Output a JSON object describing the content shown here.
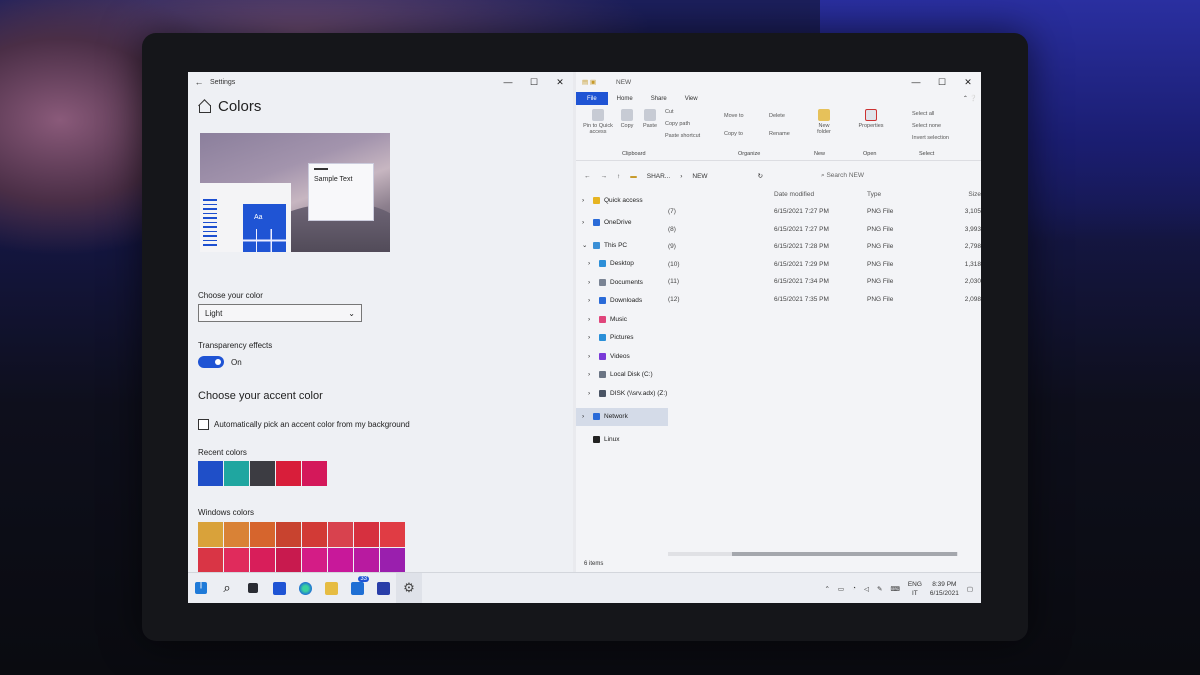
{
  "settings": {
    "window_title": "Settings",
    "heading": "Colors",
    "preview_sample_text": "Sample Text",
    "preview_tile_text": "Aa",
    "choose_color_label": "Choose your color",
    "choose_color_value": "Light",
    "transparency_label": "Transparency effects",
    "transparency_state": "On",
    "accent_heading": "Choose your accent color",
    "auto_accent_label": "Automatically pick an accent color from my background",
    "recent_colors_label": "Recent colors",
    "recent_colors": [
      "#1f4fc8",
      "#1fa6a0",
      "#3c3c42",
      "#d81e3a",
      "#d4185a"
    ],
    "windows_colors_label": "Windows colors",
    "windows_colors_row1": [
      "#d9a23a",
      "#d98236",
      "#d6652d",
      "#c8432f",
      "#d23a36",
      "#d8424e",
      "#d6303f",
      "#e03c44"
    ],
    "windows_colors_row2": [
      "#d93545",
      "#e02b5c",
      "#d81e5a",
      "#c81a4e",
      "#d41c86",
      "#c8189a",
      "#b81aa0",
      "#9a1fae"
    ]
  },
  "explorer": {
    "window_title": "NEW",
    "tabs": [
      "File",
      "Home",
      "Share",
      "View"
    ],
    "ribbon": {
      "pin": "Pin to Quick access",
      "copy": "Copy",
      "paste": "Paste",
      "cut": "Cut",
      "copy_path": "Copy path",
      "paste_shortcut": "Paste shortcut",
      "move_to": "Move to",
      "copy_to": "Copy to",
      "delete": "Delete",
      "rename": "Rename",
      "new_folder": "New folder",
      "properties": "Properties",
      "select_all": "Select all",
      "select_none": "Select none",
      "invert_selection": "Invert selection",
      "groups": [
        "Clipboard",
        "Organize",
        "New",
        "Open",
        "Select"
      ]
    },
    "address": {
      "path1": "SHAR...",
      "path2": "NEW",
      "search_placeholder": "Search NEW"
    },
    "columns": [
      "Date modified",
      "Type",
      "Size"
    ],
    "nav": [
      {
        "label": "Quick access",
        "color": "#e6b422"
      },
      {
        "label": "OneDrive",
        "color": "#2a6bd8"
      },
      {
        "label": "This PC",
        "color": "#3a8fd6"
      },
      {
        "label": "Desktop",
        "color": "#2d8fd8"
      },
      {
        "label": "Documents",
        "color": "#7a8494"
      },
      {
        "label": "Downloads",
        "color": "#2a6bd8"
      },
      {
        "label": "Music",
        "color": "#e0457b"
      },
      {
        "label": "Pictures",
        "color": "#2a8fd8"
      },
      {
        "label": "Videos",
        "color": "#7a3ad8"
      },
      {
        "label": "Local Disk (C:)",
        "color": "#6a7484"
      },
      {
        "label": "DISK (\\\\srv.adx) (Z:)",
        "color": "#4a5464"
      },
      {
        "label": "Network",
        "color": "#2a6bd8"
      },
      {
        "label": "Linux",
        "color": "#222222"
      }
    ],
    "rows": [
      {
        "name": "(7)",
        "date": "6/15/2021 7:27 PM",
        "type": "PNG File",
        "size": "3,105"
      },
      {
        "name": "(8)",
        "date": "6/15/2021 7:27 PM",
        "type": "PNG File",
        "size": "3,993"
      },
      {
        "name": "(9)",
        "date": "6/15/2021 7:28 PM",
        "type": "PNG File",
        "size": "2,798"
      },
      {
        "name": "(10)",
        "date": "6/15/2021 7:29 PM",
        "type": "PNG File",
        "size": "1,318"
      },
      {
        "name": "(11)",
        "date": "6/15/2021 7:34 PM",
        "type": "PNG File",
        "size": "2,030"
      },
      {
        "name": "(12)",
        "date": "6/15/2021 7:35 PM",
        "type": "PNG File",
        "size": "2,098"
      }
    ],
    "status": "6 items"
  },
  "taskbar": {
    "mail_badge": "33",
    "lang1": "ENG",
    "lang2": "IT",
    "time": "8:39 PM",
    "date": "6/15/2021"
  }
}
